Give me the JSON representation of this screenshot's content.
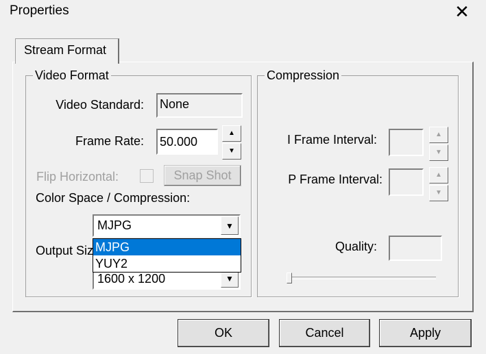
{
  "window": {
    "title": "Properties",
    "close": "✕"
  },
  "tabs": [
    {
      "label": "Stream Format"
    }
  ],
  "video_format": {
    "legend": "Video Format",
    "video_standard_label": "Video Standard:",
    "video_standard_value": "None",
    "frame_rate_label": "Frame Rate:",
    "frame_rate_value": "50.000",
    "flip_label": "Flip Horizontal:",
    "snap_shot": "Snap Shot",
    "color_space_label": "Color Space / Compression:",
    "color_space_value": "MJPG",
    "color_space_options": [
      "MJPG",
      "YUY2"
    ],
    "output_size_label": "Output Size:",
    "output_size_value": "1600 x 1200"
  },
  "compression": {
    "legend": "Compression",
    "i_frame_label": "I Frame Interval:",
    "i_frame_value": "",
    "p_frame_label": "P Frame Interval:",
    "p_frame_value": "",
    "quality_label": "Quality:",
    "quality_value": "",
    "quality_slider": 0
  },
  "buttons": {
    "ok": "OK",
    "cancel": "Cancel",
    "apply": "Apply"
  },
  "icons": {
    "up": "▲",
    "down": "▼"
  }
}
